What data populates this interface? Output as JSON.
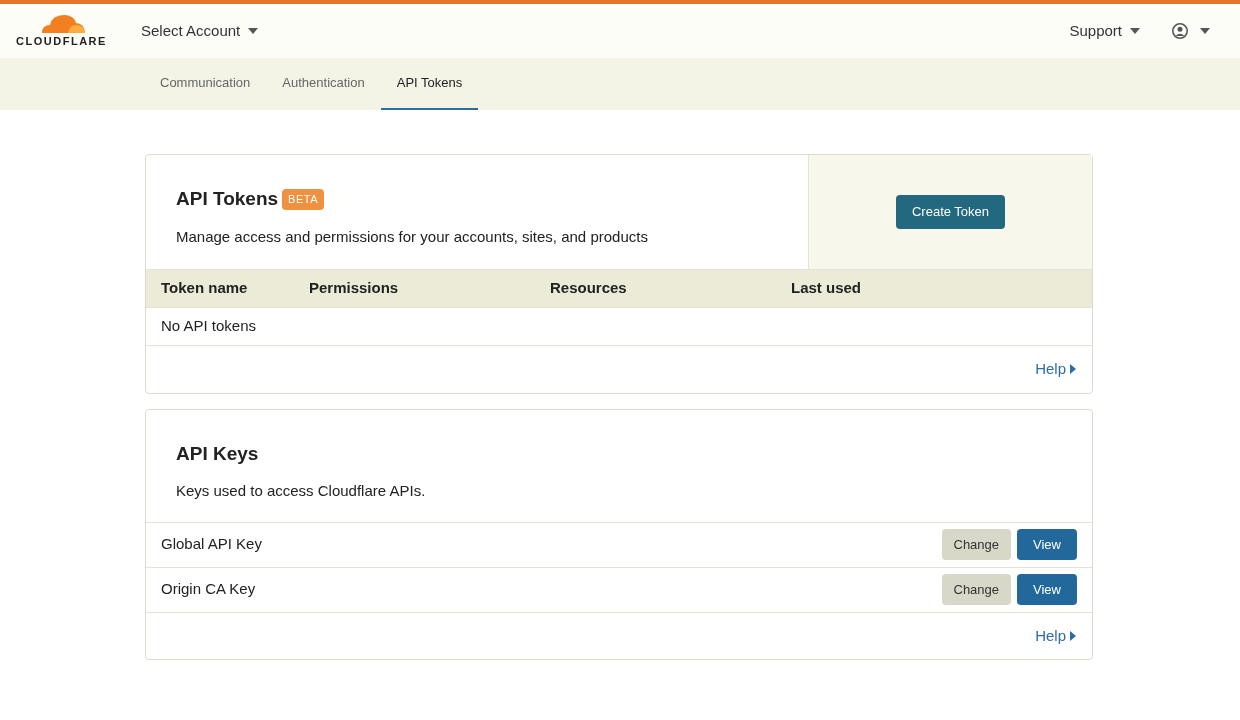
{
  "header": {
    "logo_text": "CLOUDFLARE",
    "account_menu": "Select Account",
    "support_menu": "Support"
  },
  "tabs": [
    {
      "label": "Communication",
      "selected": false
    },
    {
      "label": "Authentication",
      "selected": false
    },
    {
      "label": "API Tokens",
      "selected": true
    }
  ],
  "tokens_card": {
    "title": "API Tokens",
    "badge": "BETA",
    "description": "Manage access and permissions for your accounts, sites, and products",
    "create_button": "Create Token",
    "table": {
      "columns": [
        "Token name",
        "Permissions",
        "Resources",
        "Last used"
      ],
      "empty_text": "No API tokens"
    },
    "help_link": "Help"
  },
  "keys_card": {
    "title": "API Keys",
    "description": "Keys used to access Cloudflare APIs.",
    "rows": [
      {
        "name": "Global API Key",
        "buttons": [
          "Change",
          "View"
        ]
      },
      {
        "name": "Origin CA Key",
        "buttons": [
          "Change",
          "View"
        ]
      }
    ],
    "help_link": "Help"
  }
}
